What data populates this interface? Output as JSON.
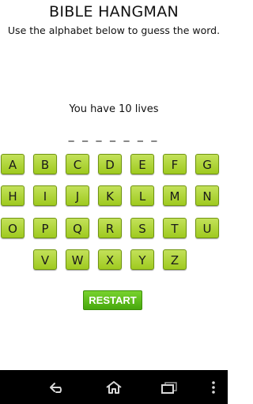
{
  "header": {
    "title": "BIBLE HANGMAN",
    "subtitle": "Use the alphabet below to guess the word."
  },
  "game": {
    "lives_text": "You have 10 lives",
    "word_blanks": "_ _ _ _ _ _ _"
  },
  "keyboard": {
    "rows": [
      [
        "A",
        "B",
        "C",
        "D",
        "E",
        "F",
        "G"
      ],
      [
        "H",
        "I",
        "J",
        "K",
        "L",
        "M",
        "N"
      ],
      [
        "O",
        "P",
        "Q",
        "R",
        "S",
        "T",
        "U"
      ],
      [
        "V",
        "W",
        "X",
        "Y",
        "Z"
      ]
    ]
  },
  "restart_label": "RESTART",
  "navbar": {
    "icons": [
      "back-icon",
      "home-icon",
      "recent-apps-icon",
      "menu-icon"
    ]
  },
  "colors": {
    "key_fill": "#a9d22c",
    "restart_fill": "#5ebd1a",
    "navbar": "#000000"
  }
}
